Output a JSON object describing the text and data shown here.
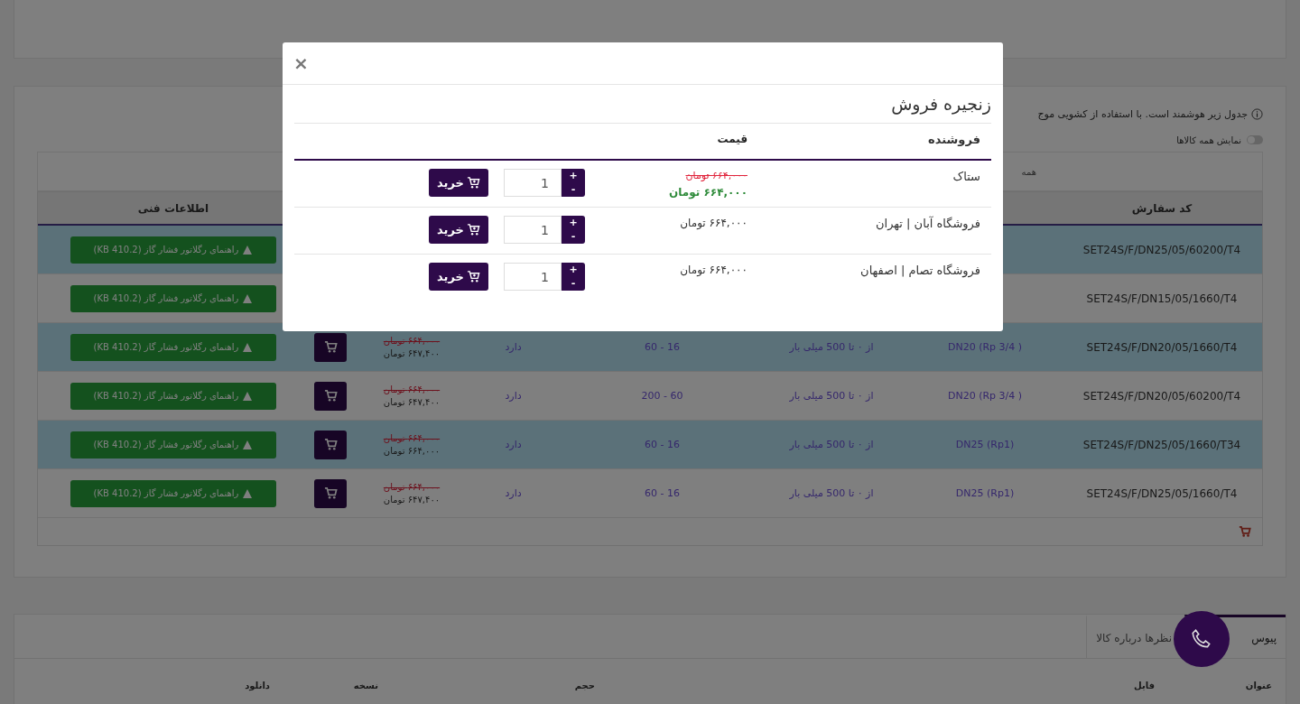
{
  "notice": {
    "text": "جدول زیر هوشمند است. با استفاده از کشویی موج"
  },
  "show_all_toggle": {
    "label": "نمایش همه کالاها",
    "on": false
  },
  "filter": {
    "value": "همه"
  },
  "product_table": {
    "columns": [
      "کد سفارش",
      "اطلاعات فنی"
    ],
    "rows": [
      {
        "code": "SET24S/F/DN25/05/60200/T4",
        "highlighted": true,
        "guide": "راهنمای رگلاتور فشار گاز (KB 410.2)"
      },
      {
        "code": "SET24S/F/DN15/05/1660/T4",
        "highlighted": false,
        "guide": "راهنمای رگلاتور فشار گاز (KB 410.2)"
      },
      {
        "code": "SET24S/F/DN20/05/1660/T4",
        "highlighted": true,
        "connection": "DN20 (Rp 3/4 )",
        "pressure": "از ۰ تا 500 میلی بار",
        "range": "16 - 60",
        "stock": "دارد",
        "old_price": "۶۶۴,۰۰۰ تومان",
        "price": "۶۴۷,۴۰۰ تومان",
        "guide": "راهنمای رگلاتور فشار گاز (KB 410.2)"
      },
      {
        "code": "SET24S/F/DN20/05/60200/T4",
        "highlighted": false,
        "connection": "DN20 (Rp 3/4 )",
        "pressure": "از ۰ تا 500 میلی بار",
        "range": "60 - 200",
        "stock": "دارد",
        "old_price": "۶۶۴,۰۰۰ تومان",
        "price": "۶۴۷,۴۰۰ تومان",
        "guide": "راهنمای رگلاتور فشار گاز (KB 410.2)"
      },
      {
        "code": "SET24S/F/DN25/05/1660/T34",
        "highlighted": true,
        "connection": "DN25 (Rp1)",
        "pressure": "از ۰ تا 500 میلی بار",
        "range": "16 - 60",
        "stock": "دارد",
        "old_price": "۶۶۴,۰۰۰ تومان",
        "price": "۶۶۴,۰۰۰ تومان",
        "guide": "راهنمای رگلاتور فشار گاز (KB 410.2)"
      },
      {
        "code": "SET24S/F/DN25/05/1660/T4",
        "highlighted": false,
        "connection": "DN25 (Rp1)",
        "pressure": "از ۰ تا 500 میلی بار",
        "range": "16 - 60",
        "stock": "دارد",
        "old_price": "۶۶۴,۰۰۰ تومان",
        "price": "۶۴۷,۴۰۰ تومان",
        "guide": "راهنمای رگلاتور فشار گاز (KB 410.2)"
      }
    ]
  },
  "bottom_section": {
    "tabs": [
      {
        "label": "پیوس",
        "selected": true
      },
      {
        "label": "نظرها درباره کالا",
        "selected": false
      }
    ],
    "columns": [
      "عنوان",
      "فایل",
      "حجم",
      "نسخه",
      "دانلود"
    ]
  },
  "modal": {
    "close": "×",
    "title": "زنجیره فروش",
    "columns": [
      "فروشنده",
      "قیمت"
    ],
    "sellers": [
      {
        "name": "ستاک",
        "kind": "discount",
        "old_price": "۶۶۴,۰۰۰ تومان",
        "price": "۶۶۴,۰۰۰ تومان",
        "quantity": "1",
        "plus": "+",
        "minus": "-",
        "buy": "خرید"
      },
      {
        "name": "فروشگاه آبان | تهران",
        "kind": "plain",
        "price": "۶۶۴,۰۰۰ تومان",
        "quantity": "1",
        "plus": "+",
        "minus": "-",
        "buy": "خرید"
      },
      {
        "name": "فروشگاه تصام | اصفهان",
        "kind": "plain",
        "price": "۶۶۴,۰۰۰ تومان",
        "quantity": "1",
        "plus": "+",
        "minus": "-",
        "buy": "خرید"
      }
    ]
  }
}
